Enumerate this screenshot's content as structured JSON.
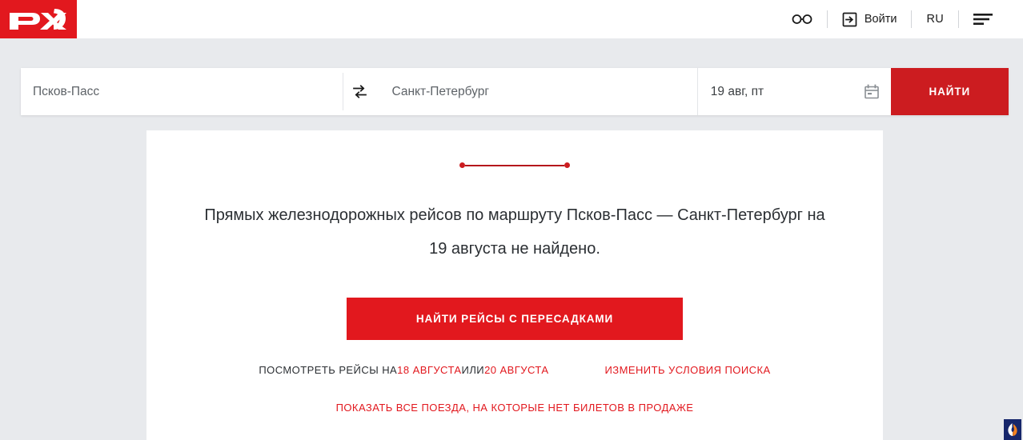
{
  "header": {
    "logo_alt": "РЖД",
    "accessibility_label": "",
    "login_label": "Войти",
    "lang_label": "RU"
  },
  "search": {
    "from_value": "Псков-Пасс",
    "to_value": "Санкт-Петербург",
    "date_value": "19 авг, пт",
    "search_button": "НАЙТИ"
  },
  "main": {
    "message": "Прямых железнодорожных рейсов по маршруту Псков-Пасс — Санкт-Петербург на 19 августа не найдено.",
    "cta_button": "НАЙТИ РЕЙСЫ С ПЕРЕСАДКАМИ",
    "alt_prefix": "ПОСМОТРЕТЬ РЕЙСЫ НА ",
    "alt_date_prev": "18 АВГУСТА",
    "alt_or": " ИЛИ ",
    "alt_date_next": "20 АВГУСТА",
    "change_search": "ИЗМЕНИТЬ УСЛОВИЯ ПОИСКА",
    "show_all_trains": "ПОКАЗАТЬ ВСЕ ПОЕЗДА, НА КОТОРЫЕ НЕТ БИЛЕТОВ В ПРОДАЖЕ"
  },
  "colors": {
    "brand_red": "#e2181e",
    "button_red": "#cc1c20",
    "page_bg": "#e8eaed"
  }
}
